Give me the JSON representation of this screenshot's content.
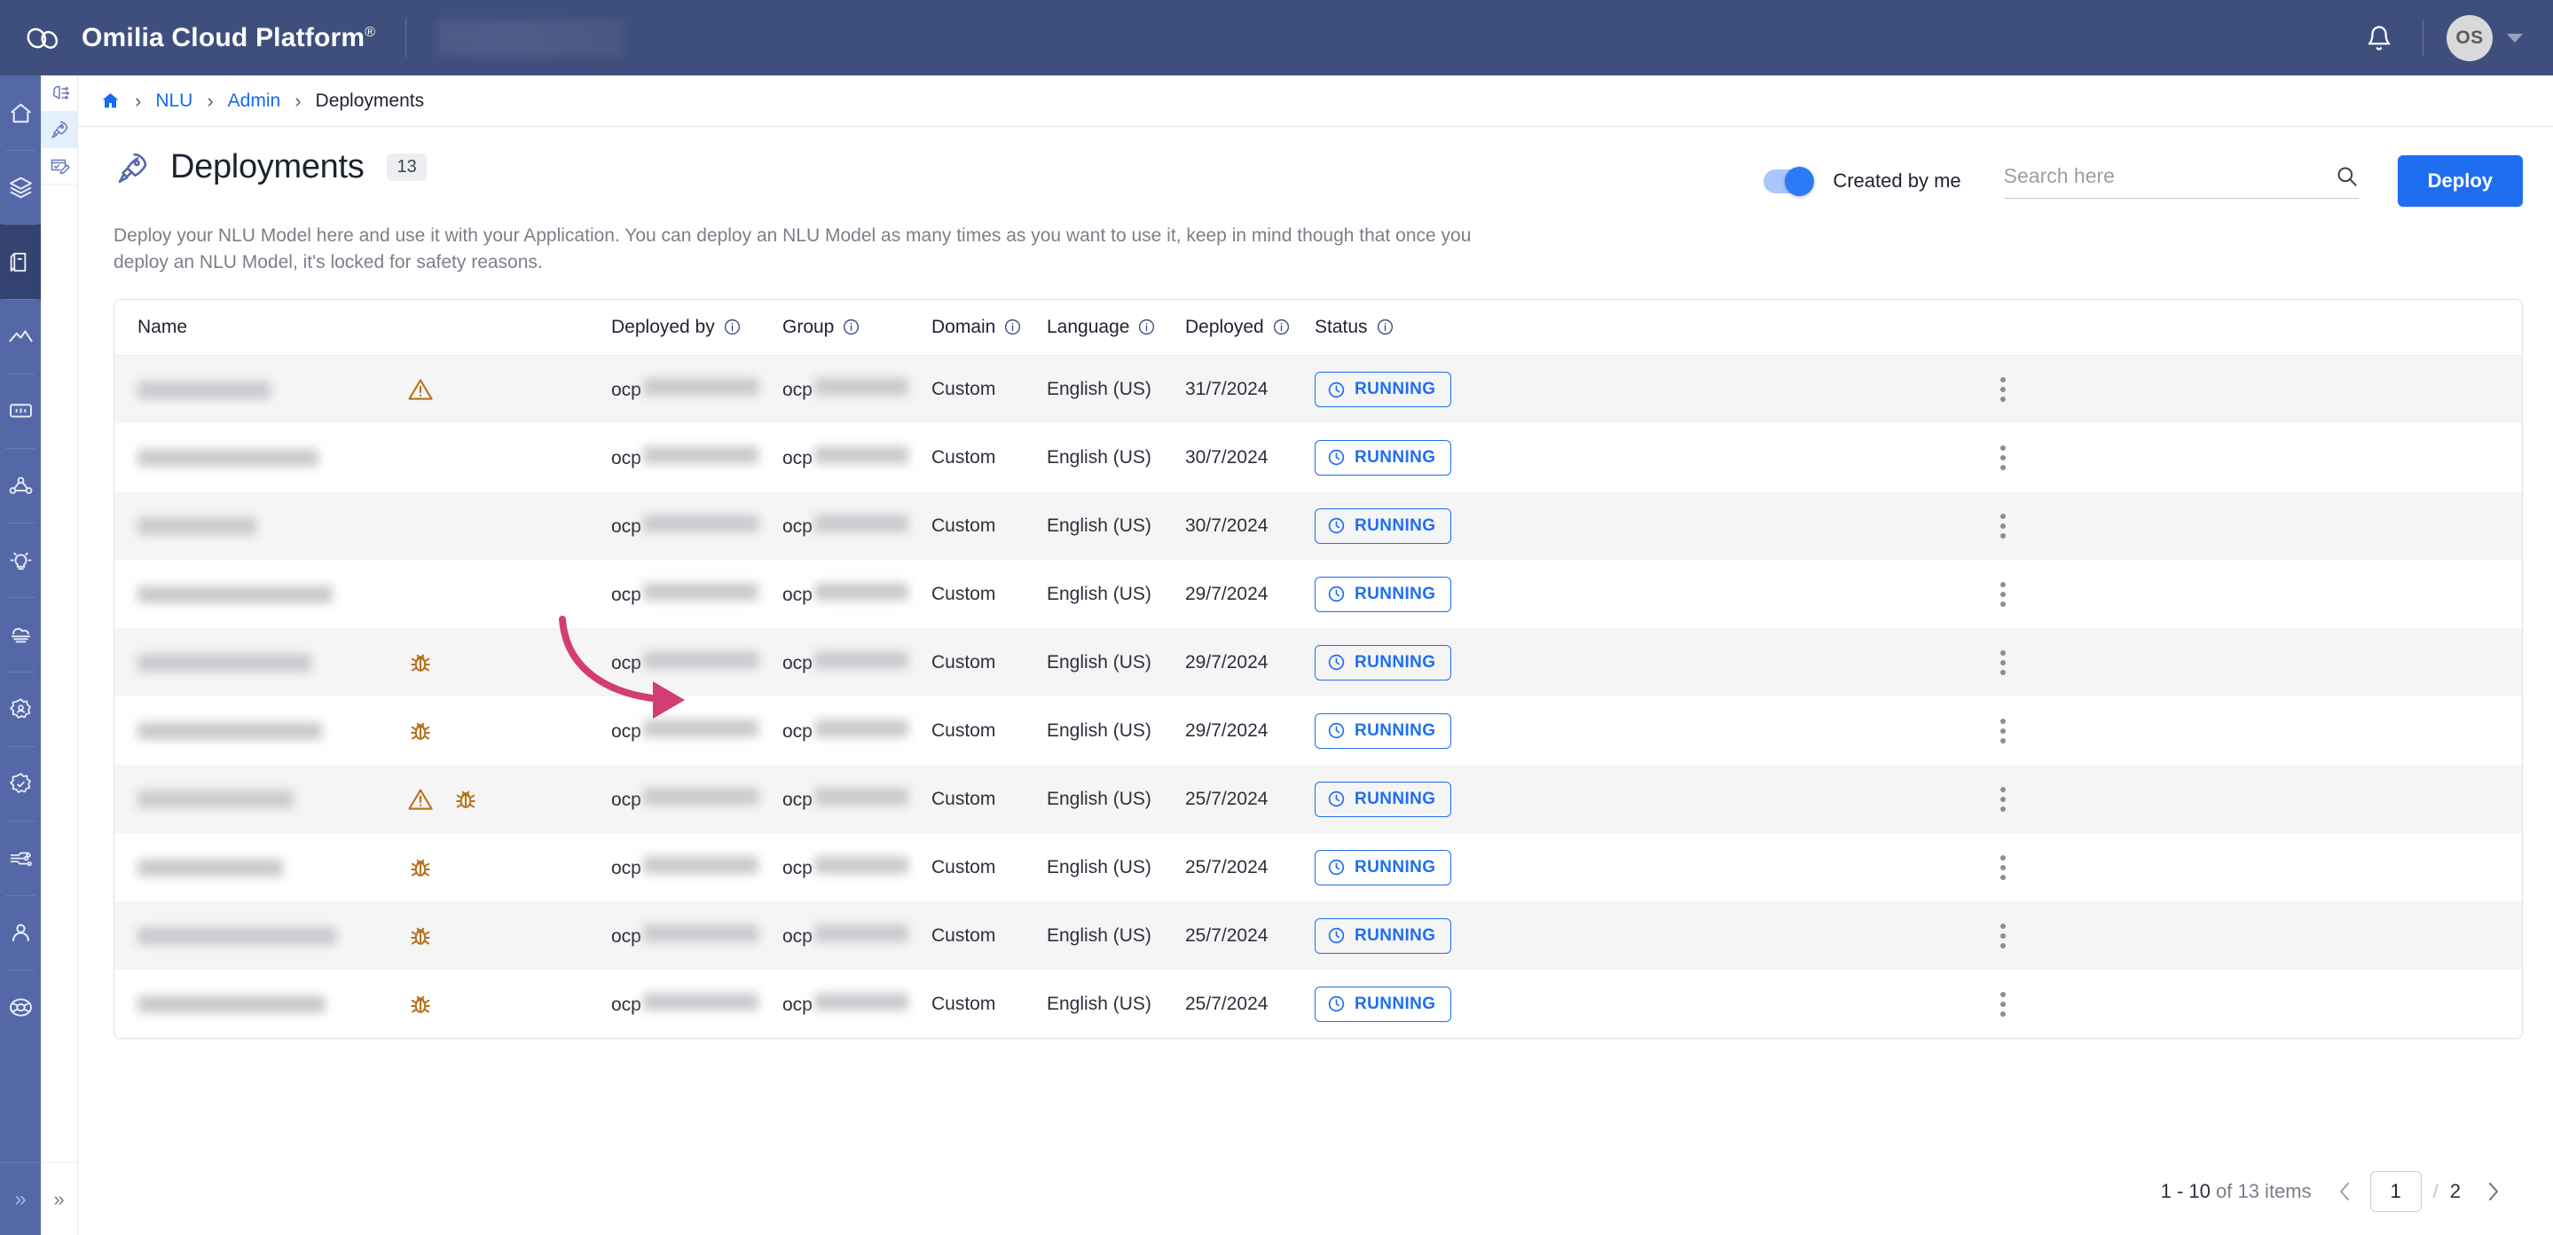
{
  "topbar": {
    "brand": "Omilia Cloud Platform",
    "brand_sup": "®",
    "notifications_icon": "bell-icon",
    "avatar_initials": "OS"
  },
  "rail": {
    "items": [
      {
        "icon": "home-icon",
        "active": false
      },
      {
        "icon": "layers-icon",
        "active": false
      },
      {
        "icon": "box-icon",
        "active": true
      },
      {
        "icon": "analytics-icon",
        "active": false
      },
      {
        "icon": "dialog-icon",
        "active": false
      },
      {
        "icon": "flow-icon",
        "active": false
      },
      {
        "icon": "idea-icon",
        "active": false
      },
      {
        "icon": "cloud-icon",
        "active": false
      },
      {
        "icon": "settings-user-icon",
        "active": false
      },
      {
        "icon": "settings-check-icon",
        "active": false
      },
      {
        "icon": "integrations-icon",
        "active": false
      },
      {
        "icon": "person-icon",
        "active": false
      },
      {
        "icon": "lifebuoy-icon",
        "active": false
      }
    ],
    "collapse_label": "»"
  },
  "subrail": {
    "items": [
      {
        "icon": "brain-icon",
        "active": false
      },
      {
        "icon": "rocket-icon",
        "active": true
      },
      {
        "icon": "annotate-icon",
        "active": false
      }
    ],
    "collapse_label": "»"
  },
  "breadcrumb": {
    "home_icon": "home-icon",
    "separator": "›",
    "items": [
      "NLU",
      "Admin"
    ],
    "current": "Deployments"
  },
  "header": {
    "icon": "rocket-icon",
    "title": "Deployments",
    "count": "13",
    "description": "Deploy your NLU Model here and use it with your Application. You can deploy an NLU Model as many times as you want to use it, keep in mind though that once you deploy an NLU Model, it's locked for safety reasons."
  },
  "toolbar": {
    "toggle_label": "Created by me",
    "toggle_on": true,
    "search_placeholder": "Search here",
    "search_value": "",
    "search_icon": "search-icon",
    "deploy_label": "Deploy"
  },
  "table": {
    "columns": [
      {
        "label": "Name",
        "info": false
      },
      {
        "label": "",
        "info": false
      },
      {
        "label": "Deployed by",
        "info": true
      },
      {
        "label": "Group",
        "info": true
      },
      {
        "label": "Domain",
        "info": true
      },
      {
        "label": "Language",
        "info": true
      },
      {
        "label": "Deployed",
        "info": true
      },
      {
        "label": "Status",
        "info": true
      },
      {
        "label": "",
        "info": false
      }
    ],
    "rows": [
      {
        "name_w": 150,
        "alerts": [
          "warning-icon"
        ],
        "deployed_by_prefix": "ocp",
        "deployed_by_w": 130,
        "group_prefix": "ocp",
        "group_w": 106,
        "domain": "Custom",
        "language": "English (US)",
        "deployed": "31/7/2024",
        "status": "RUNNING"
      },
      {
        "name_w": 204,
        "alerts": [],
        "deployed_by_prefix": "ocp",
        "deployed_by_w": 130,
        "group_prefix": "ocp",
        "group_w": 106,
        "domain": "Custom",
        "language": "English (US)",
        "deployed": "30/7/2024",
        "status": "RUNNING"
      },
      {
        "name_w": 134,
        "alerts": [],
        "deployed_by_prefix": "ocp",
        "deployed_by_w": 130,
        "group_prefix": "ocp",
        "group_w": 106,
        "domain": "Custom",
        "language": "English (US)",
        "deployed": "30/7/2024",
        "status": "RUNNING"
      },
      {
        "name_w": 220,
        "alerts": [],
        "deployed_by_prefix": "ocp",
        "deployed_by_w": 130,
        "group_prefix": "ocp",
        "group_w": 106,
        "domain": "Custom",
        "language": "English (US)",
        "deployed": "29/7/2024",
        "status": "RUNNING"
      },
      {
        "name_w": 196,
        "alerts": [
          "bug-icon"
        ],
        "deployed_by_prefix": "ocp",
        "deployed_by_w": 130,
        "group_prefix": "ocp",
        "group_w": 106,
        "domain": "Custom",
        "language": "English (US)",
        "deployed": "29/7/2024",
        "status": "RUNNING"
      },
      {
        "name_w": 208,
        "alerts": [
          "bug-icon"
        ],
        "deployed_by_prefix": "ocp",
        "deployed_by_w": 130,
        "group_prefix": "ocp",
        "group_w": 106,
        "domain": "Custom",
        "language": "English (US)",
        "deployed": "29/7/2024",
        "status": "RUNNING"
      },
      {
        "name_w": 176,
        "alerts": [
          "warning-icon",
          "bug-icon"
        ],
        "deployed_by_prefix": "ocp",
        "deployed_by_w": 130,
        "group_prefix": "ocp",
        "group_w": 106,
        "domain": "Custom",
        "language": "English (US)",
        "deployed": "25/7/2024",
        "status": "RUNNING"
      },
      {
        "name_w": 164,
        "alerts": [
          "bug-icon"
        ],
        "deployed_by_prefix": "ocp",
        "deployed_by_w": 130,
        "group_prefix": "ocp",
        "group_w": 106,
        "domain": "Custom",
        "language": "English (US)",
        "deployed": "25/7/2024",
        "status": "RUNNING"
      },
      {
        "name_w": 224,
        "alerts": [
          "bug-icon"
        ],
        "deployed_by_prefix": "ocp",
        "deployed_by_w": 130,
        "group_prefix": "ocp",
        "group_w": 106,
        "domain": "Custom",
        "language": "English (US)",
        "deployed": "25/7/2024",
        "status": "RUNNING"
      },
      {
        "name_w": 212,
        "alerts": [
          "bug-icon"
        ],
        "deployed_by_prefix": "ocp",
        "deployed_by_w": 130,
        "group_prefix": "ocp",
        "group_w": 106,
        "domain": "Custom",
        "language": "English (US)",
        "deployed": "25/7/2024",
        "status": "RUNNING"
      }
    ]
  },
  "pagination": {
    "range": "1 - 10",
    "of_text": "of 13 items",
    "prev_icon": "chevron-left-icon",
    "next_icon": "chevron-right-icon",
    "current_page": "1",
    "separator": "/",
    "total_pages": "2"
  },
  "annotation": {
    "arrow_color": "#d33d74",
    "points_to": "bug-icon"
  },
  "colors": {
    "brand_navy": "#3f4f7d",
    "rail_blue": "#5468a8",
    "accent_blue": "#1f6ef0",
    "link_blue": "#1669f2",
    "warn_amber": "#b5711b",
    "annotation_pink": "#d33d74"
  }
}
